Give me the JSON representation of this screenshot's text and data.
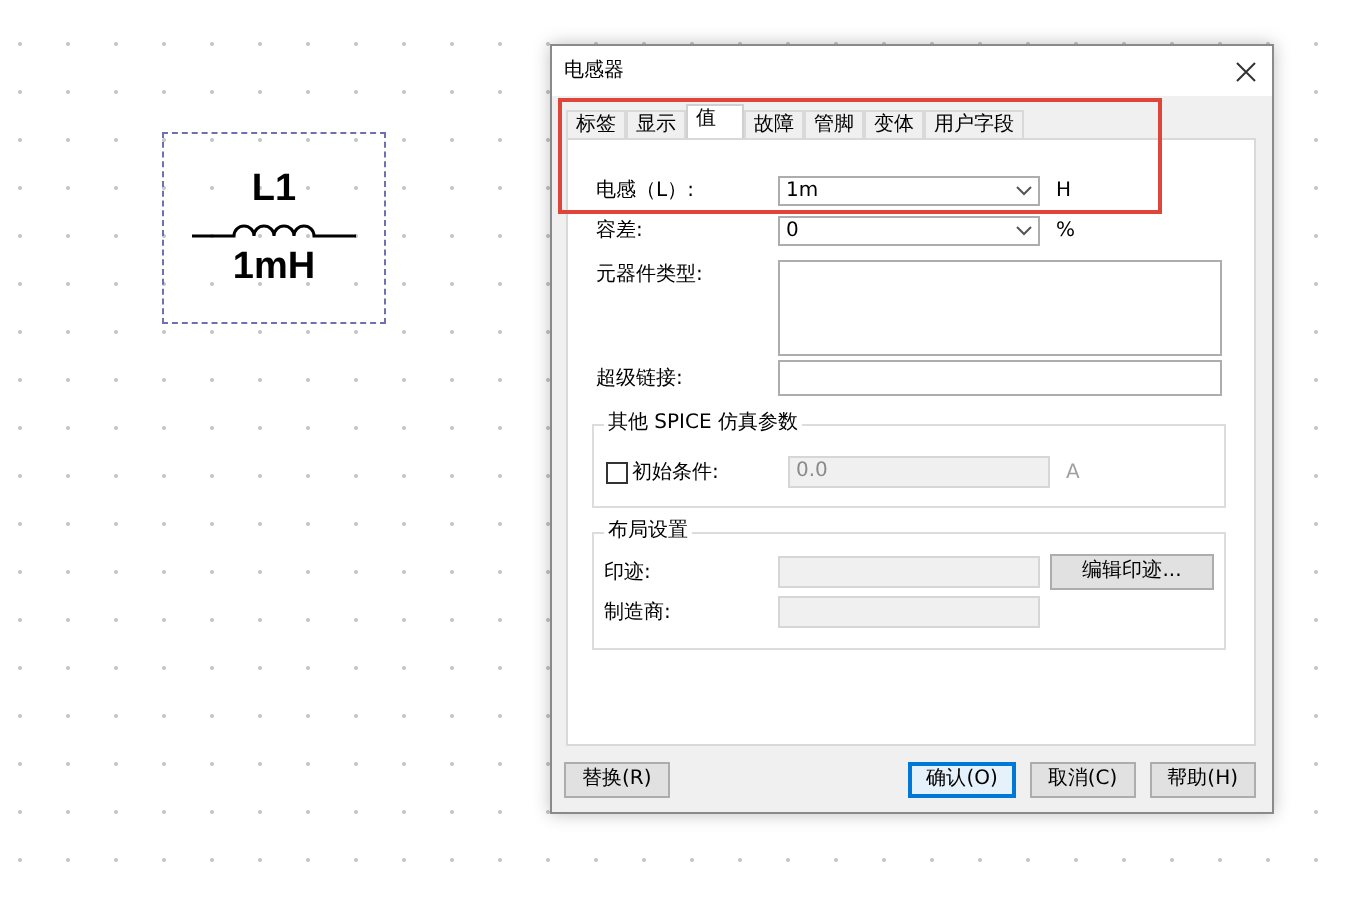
{
  "canvas": {
    "component": {
      "designator": "L1",
      "value": "1mH"
    }
  },
  "dialog": {
    "title": "电感器",
    "tabs": [
      {
        "label": "标签",
        "selected": false
      },
      {
        "label": "显示",
        "selected": false
      },
      {
        "label": "值",
        "selected": true
      },
      {
        "label": "故障",
        "selected": false
      },
      {
        "label": "管脚",
        "selected": false
      },
      {
        "label": "变体",
        "selected": false
      },
      {
        "label": "用户字段",
        "selected": false
      }
    ],
    "inductance": {
      "label": "电感（L）:",
      "value": "1m",
      "unit": "H"
    },
    "tolerance": {
      "label": "容差:",
      "value": "0",
      "unit": "%"
    },
    "component_type": {
      "label": "元器件类型:"
    },
    "hyperlink": {
      "label": "超级链接:"
    },
    "spice_group": {
      "title": "其他 SPICE 仿真参数",
      "initial_condition": {
        "label": "初始条件:",
        "checked": false,
        "disabled": true,
        "value": "0.0",
        "unit": "A"
      }
    },
    "layout_group": {
      "title": "布局设置",
      "footprint": {
        "label": "印迹:",
        "button": "编辑印迹..."
      },
      "manufacturer": {
        "label": "制造商:"
      }
    },
    "buttons": [
      {
        "label": "替换(R)",
        "default": false
      },
      {
        "label": "确认(O)",
        "default": true
      },
      {
        "label": "取消(C)",
        "default": false
      },
      {
        "label": "帮助(H)",
        "default": false
      }
    ]
  },
  "annotation": {
    "kind": "highlight"
  }
}
